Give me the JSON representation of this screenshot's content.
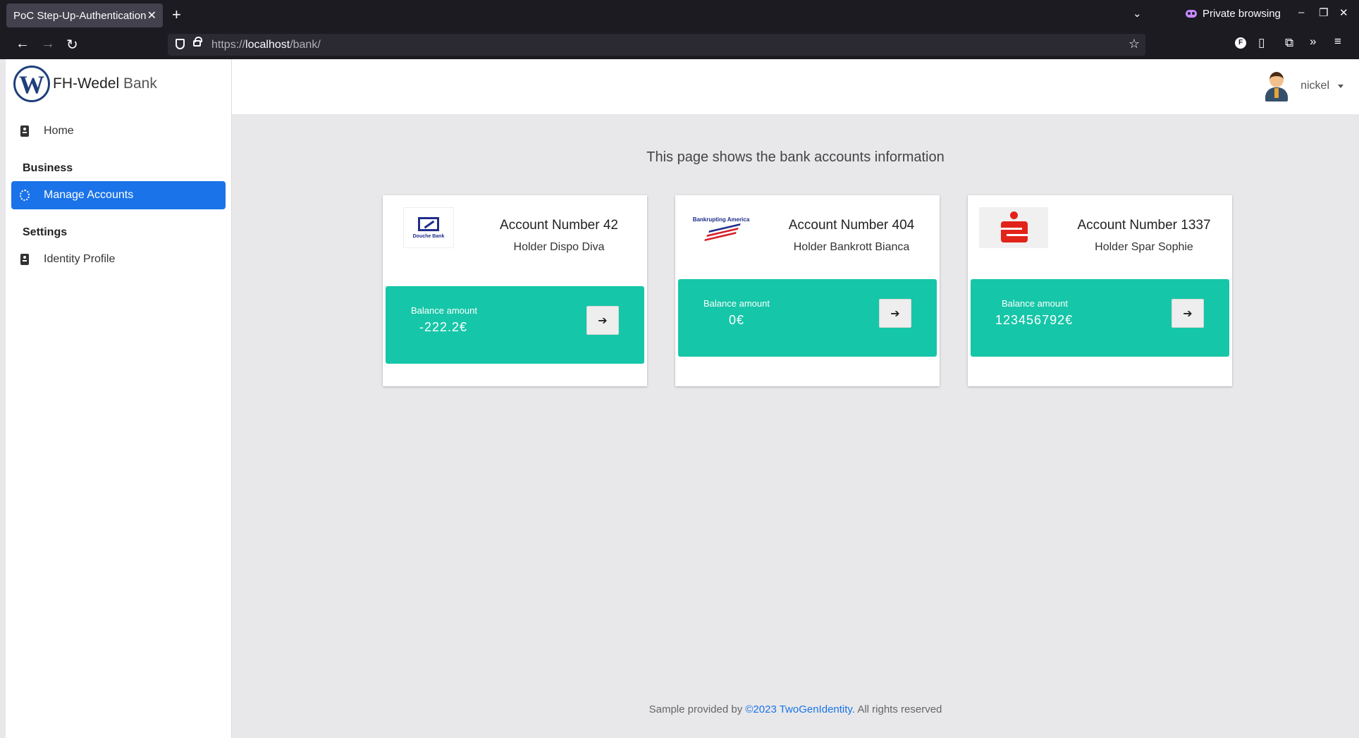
{
  "browser": {
    "tab_title": "PoC Step-Up-Authentication",
    "new_tab": "+",
    "private_label": "Private browsing",
    "url_prefix": "https://",
    "url_host": "localhost",
    "url_path": "/bank/"
  },
  "sidebar": {
    "brand_name": "FH-Wedel",
    "brand_suffix": "Bank",
    "home_label": "Home",
    "sections": [
      {
        "title": "Business",
        "items": [
          {
            "label": "Manage Accounts",
            "active": true
          }
        ]
      },
      {
        "title": "Settings",
        "items": [
          {
            "label": "Identity Profile",
            "active": false
          }
        ]
      }
    ]
  },
  "header": {
    "username": "nickel"
  },
  "main": {
    "title": "This page shows the bank accounts information",
    "accounts": [
      {
        "title": "Account Number 42",
        "holder": "Holder Dispo Diva",
        "balance_label": "Balance amount",
        "balance": "-222.2€",
        "logo": "Douche Bank"
      },
      {
        "title": "Account Number 404",
        "holder": "Holder Bankrott Bianca",
        "balance_label": "Balance amount",
        "balance": "0€",
        "logo": "Bankrupting America"
      },
      {
        "title": "Account Number 1337",
        "holder": "Holder Spar Sophie",
        "balance_label": "Balance amount",
        "balance": "123456792€",
        "logo": "sparkasse-icon"
      }
    ]
  },
  "footer": {
    "prefix": "Sample provided by",
    "link": "©2023 TwoGenIdentity.",
    "suffix": "All rights reserved"
  },
  "colors": {
    "accent": "#1a73e8",
    "balance_bg": "#16c6a8"
  }
}
